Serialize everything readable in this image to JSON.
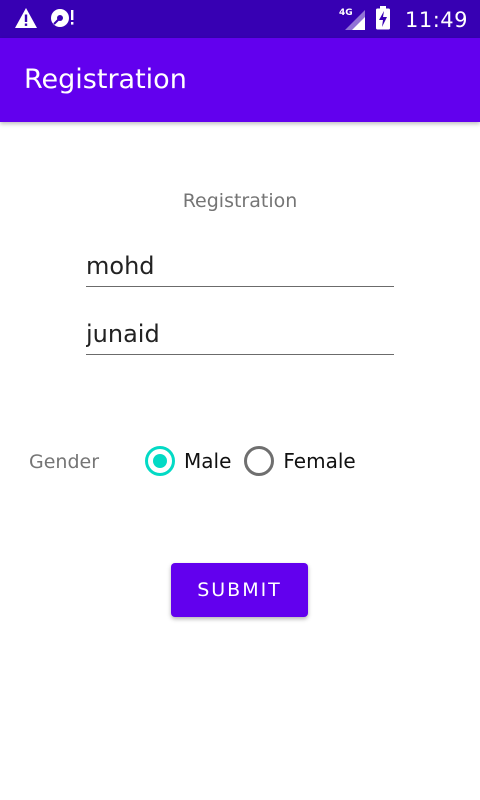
{
  "status_bar": {
    "time": "11:49",
    "network": "4G",
    "icons": [
      "warning-icon",
      "sd-card-alert-icon",
      "signal-icon",
      "battery-charging-icon"
    ]
  },
  "app_bar": {
    "title": "Registration"
  },
  "form": {
    "heading": "Registration",
    "first_name_value": "mohd",
    "last_name_value": "junaid",
    "gender_label": "Gender",
    "gender_options": [
      {
        "label": "Male",
        "checked": true
      },
      {
        "label": "Female",
        "checked": false
      }
    ],
    "submit_label": "SUBMIT"
  },
  "colors": {
    "status_bar": "#3700b3",
    "primary": "#6200ee",
    "accent": "#03dac5"
  }
}
